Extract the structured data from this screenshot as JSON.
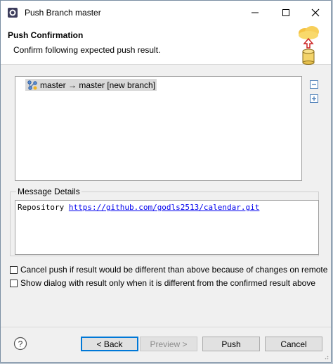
{
  "window": {
    "title": "Push Branch master"
  },
  "header": {
    "title": "Push Confirmation",
    "description": "Confirm following expected push result."
  },
  "tree": {
    "items": [
      {
        "label": "master → master [new branch]"
      }
    ]
  },
  "message_details": {
    "label": "Message Details",
    "repository_label": "Repository",
    "repository_url": "https://github.com/godls2513/calendar.git"
  },
  "options": {
    "cancel_push": "Cancel push if result would be different than above because of changes on remote",
    "show_dialog": "Show dialog with result only when it is different from the confirmed result above"
  },
  "buttons": {
    "back": "< Back",
    "preview": "Preview >",
    "push": "Push",
    "cancel": "Cancel"
  },
  "colors": {
    "accent": "#0078d7",
    "link": "#0000ee"
  }
}
